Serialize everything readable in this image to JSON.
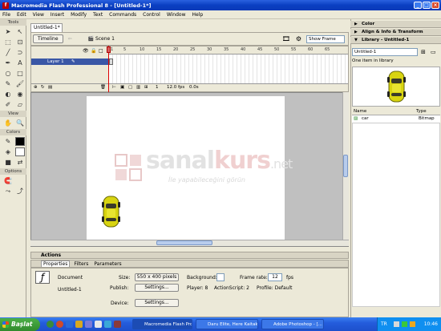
{
  "window": {
    "title": "Macromedia Flash Professional 8 - [Untitled-1*]"
  },
  "menu": [
    "File",
    "Edit",
    "View",
    "Insert",
    "Modify",
    "Text",
    "Commands",
    "Control",
    "Window",
    "Help"
  ],
  "tools": {
    "header": "Tools",
    "view_label": "View",
    "colors_label": "Colors",
    "options_label": "Options"
  },
  "document": {
    "tab": "Untitled-1*",
    "timeline_button": "Timeline",
    "scene": "Scene 1",
    "zoom": "Show Frame"
  },
  "timeline": {
    "layer_name": "Layer 1",
    "ruler_ticks": [
      "1",
      "5",
      "10",
      "15",
      "20",
      "25",
      "30",
      "35",
      "40",
      "45",
      "50",
      "55",
      "60",
      "65"
    ],
    "frame": "1",
    "fps": "12.0 fps",
    "time": "0.0s"
  },
  "watermark": {
    "brand_a": "sanal",
    "brand_b": "kurs",
    "tld": ".net",
    "slogan": "İle yapabileceğini görün"
  },
  "panels": {
    "actions": "Actions",
    "tabs": [
      "Properties",
      "Filters",
      "Parameters"
    ],
    "doc_label": "Document",
    "doc_name": "Untitled-1",
    "size_label": "Size:",
    "size_value": "550 x 400 pixels",
    "background_label": "Background:",
    "framerate_label": "Frame rate:",
    "framerate_value": "12",
    "fps_unit": "fps",
    "publish_label": "Publish:",
    "settings_button": "Settings...",
    "player": "Player: 8",
    "actionscript": "ActionScript: 2",
    "profile": "Profile: Default",
    "device_label": "Device:"
  },
  "right_panels": {
    "color": "Color",
    "align": "Align & Info & Transform",
    "library": "Library - Untitled-1",
    "library_select": "Untitled-1",
    "library_count": "One item in library",
    "col_name": "Name",
    "col_type": "Type",
    "item_name": "car",
    "item_type": "Bitmap"
  },
  "taskbar": {
    "start": "Başlat",
    "items": [
      "Macromedia Flash Pro...",
      "Daru Elite, Here Kaitakk...",
      "Adobe Photoshop - [..."
    ],
    "lang": "TR",
    "clock": "10:46"
  },
  "colors": {
    "titlebar": "#0a3fc2",
    "stage": "#ffffff",
    "car": "#d8d410",
    "layer_selected": "#3a57a6"
  }
}
